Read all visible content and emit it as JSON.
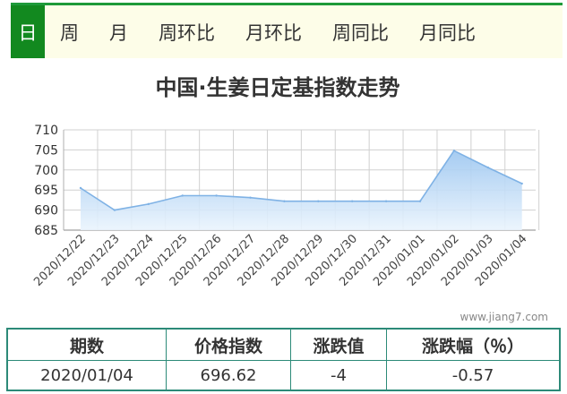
{
  "tabs": [
    {
      "label": "日",
      "active": true
    },
    {
      "label": "周",
      "active": false
    },
    {
      "label": "月",
      "active": false
    },
    {
      "label": "周环比",
      "active": false
    },
    {
      "label": "月环比",
      "active": false
    },
    {
      "label": "周同比",
      "active": false
    },
    {
      "label": "月同比",
      "active": false
    }
  ],
  "chart_data": {
    "type": "area",
    "title": "中国·生姜日定基指数走势",
    "categories": [
      "2020/12/22",
      "2020/12/23",
      "2020/12/24",
      "2020/12/25",
      "2020/12/26",
      "2020/12/27",
      "2020/12/28",
      "2020/12/29",
      "2020/12/30",
      "2020/12/31",
      "2020/01/01",
      "2020/01/02",
      "2020/01/03",
      "2020/01/04"
    ],
    "series": [
      {
        "values": [
          695.5,
          690.0,
          691.5,
          693.6,
          693.6,
          693.1,
          692.2,
          692.2,
          692.2,
          692.2,
          692.2,
          704.8,
          700.6,
          696.6
        ]
      }
    ],
    "ylim": [
      685,
      710
    ],
    "yticks": [
      685,
      690,
      695,
      700,
      705,
      710
    ],
    "grid": true,
    "watermark": "www.jiang7.com",
    "colors": {
      "line": "#7fb2e5",
      "fill_top": "#9cc6f0",
      "fill_bottom": "#eaf4fd",
      "grid": "#d0d0d0",
      "axis": "#b0b0b0"
    }
  },
  "table": {
    "headers": [
      "期数",
      "价格指数",
      "涨跌值",
      "涨跌幅（％）"
    ],
    "rows": [
      [
        "2020/01/04",
        "696.62",
        "-4",
        "-0.57"
      ]
    ]
  }
}
